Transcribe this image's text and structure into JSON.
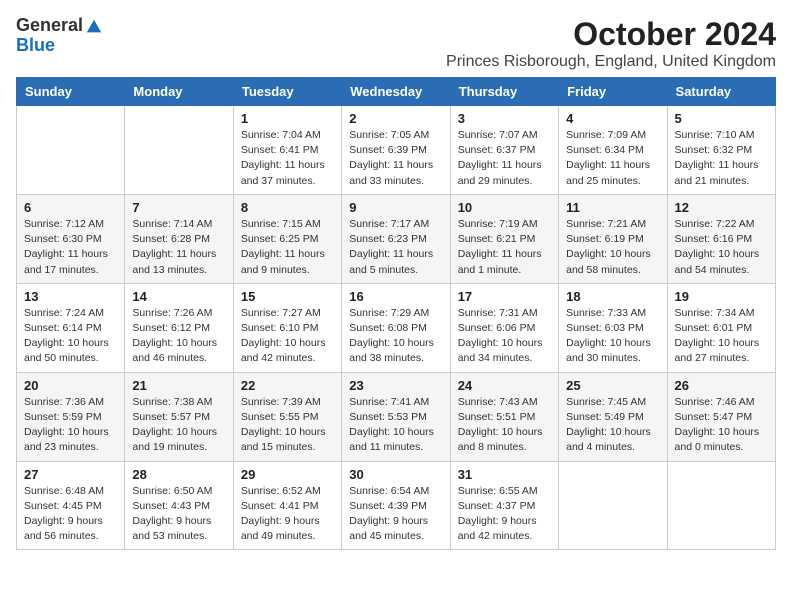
{
  "logo": {
    "general": "General",
    "blue": "Blue"
  },
  "title": "October 2024",
  "location": "Princes Risborough, England, United Kingdom",
  "weekdays": [
    "Sunday",
    "Monday",
    "Tuesday",
    "Wednesday",
    "Thursday",
    "Friday",
    "Saturday"
  ],
  "weeks": [
    [
      {
        "day": null
      },
      {
        "day": null
      },
      {
        "day": 1,
        "sunrise": "Sunrise: 7:04 AM",
        "sunset": "Sunset: 6:41 PM",
        "daylight": "Daylight: 11 hours and 37 minutes."
      },
      {
        "day": 2,
        "sunrise": "Sunrise: 7:05 AM",
        "sunset": "Sunset: 6:39 PM",
        "daylight": "Daylight: 11 hours and 33 minutes."
      },
      {
        "day": 3,
        "sunrise": "Sunrise: 7:07 AM",
        "sunset": "Sunset: 6:37 PM",
        "daylight": "Daylight: 11 hours and 29 minutes."
      },
      {
        "day": 4,
        "sunrise": "Sunrise: 7:09 AM",
        "sunset": "Sunset: 6:34 PM",
        "daylight": "Daylight: 11 hours and 25 minutes."
      },
      {
        "day": 5,
        "sunrise": "Sunrise: 7:10 AM",
        "sunset": "Sunset: 6:32 PM",
        "daylight": "Daylight: 11 hours and 21 minutes."
      }
    ],
    [
      {
        "day": 6,
        "sunrise": "Sunrise: 7:12 AM",
        "sunset": "Sunset: 6:30 PM",
        "daylight": "Daylight: 11 hours and 17 minutes."
      },
      {
        "day": 7,
        "sunrise": "Sunrise: 7:14 AM",
        "sunset": "Sunset: 6:28 PM",
        "daylight": "Daylight: 11 hours and 13 minutes."
      },
      {
        "day": 8,
        "sunrise": "Sunrise: 7:15 AM",
        "sunset": "Sunset: 6:25 PM",
        "daylight": "Daylight: 11 hours and 9 minutes."
      },
      {
        "day": 9,
        "sunrise": "Sunrise: 7:17 AM",
        "sunset": "Sunset: 6:23 PM",
        "daylight": "Daylight: 11 hours and 5 minutes."
      },
      {
        "day": 10,
        "sunrise": "Sunrise: 7:19 AM",
        "sunset": "Sunset: 6:21 PM",
        "daylight": "Daylight: 11 hours and 1 minute."
      },
      {
        "day": 11,
        "sunrise": "Sunrise: 7:21 AM",
        "sunset": "Sunset: 6:19 PM",
        "daylight": "Daylight: 10 hours and 58 minutes."
      },
      {
        "day": 12,
        "sunrise": "Sunrise: 7:22 AM",
        "sunset": "Sunset: 6:16 PM",
        "daylight": "Daylight: 10 hours and 54 minutes."
      }
    ],
    [
      {
        "day": 13,
        "sunrise": "Sunrise: 7:24 AM",
        "sunset": "Sunset: 6:14 PM",
        "daylight": "Daylight: 10 hours and 50 minutes."
      },
      {
        "day": 14,
        "sunrise": "Sunrise: 7:26 AM",
        "sunset": "Sunset: 6:12 PM",
        "daylight": "Daylight: 10 hours and 46 minutes."
      },
      {
        "day": 15,
        "sunrise": "Sunrise: 7:27 AM",
        "sunset": "Sunset: 6:10 PM",
        "daylight": "Daylight: 10 hours and 42 minutes."
      },
      {
        "day": 16,
        "sunrise": "Sunrise: 7:29 AM",
        "sunset": "Sunset: 6:08 PM",
        "daylight": "Daylight: 10 hours and 38 minutes."
      },
      {
        "day": 17,
        "sunrise": "Sunrise: 7:31 AM",
        "sunset": "Sunset: 6:06 PM",
        "daylight": "Daylight: 10 hours and 34 minutes."
      },
      {
        "day": 18,
        "sunrise": "Sunrise: 7:33 AM",
        "sunset": "Sunset: 6:03 PM",
        "daylight": "Daylight: 10 hours and 30 minutes."
      },
      {
        "day": 19,
        "sunrise": "Sunrise: 7:34 AM",
        "sunset": "Sunset: 6:01 PM",
        "daylight": "Daylight: 10 hours and 27 minutes."
      }
    ],
    [
      {
        "day": 20,
        "sunrise": "Sunrise: 7:36 AM",
        "sunset": "Sunset: 5:59 PM",
        "daylight": "Daylight: 10 hours and 23 minutes."
      },
      {
        "day": 21,
        "sunrise": "Sunrise: 7:38 AM",
        "sunset": "Sunset: 5:57 PM",
        "daylight": "Daylight: 10 hours and 19 minutes."
      },
      {
        "day": 22,
        "sunrise": "Sunrise: 7:39 AM",
        "sunset": "Sunset: 5:55 PM",
        "daylight": "Daylight: 10 hours and 15 minutes."
      },
      {
        "day": 23,
        "sunrise": "Sunrise: 7:41 AM",
        "sunset": "Sunset: 5:53 PM",
        "daylight": "Daylight: 10 hours and 11 minutes."
      },
      {
        "day": 24,
        "sunrise": "Sunrise: 7:43 AM",
        "sunset": "Sunset: 5:51 PM",
        "daylight": "Daylight: 10 hours and 8 minutes."
      },
      {
        "day": 25,
        "sunrise": "Sunrise: 7:45 AM",
        "sunset": "Sunset: 5:49 PM",
        "daylight": "Daylight: 10 hours and 4 minutes."
      },
      {
        "day": 26,
        "sunrise": "Sunrise: 7:46 AM",
        "sunset": "Sunset: 5:47 PM",
        "daylight": "Daylight: 10 hours and 0 minutes."
      }
    ],
    [
      {
        "day": 27,
        "sunrise": "Sunrise: 6:48 AM",
        "sunset": "Sunset: 4:45 PM",
        "daylight": "Daylight: 9 hours and 56 minutes."
      },
      {
        "day": 28,
        "sunrise": "Sunrise: 6:50 AM",
        "sunset": "Sunset: 4:43 PM",
        "daylight": "Daylight: 9 hours and 53 minutes."
      },
      {
        "day": 29,
        "sunrise": "Sunrise: 6:52 AM",
        "sunset": "Sunset: 4:41 PM",
        "daylight": "Daylight: 9 hours and 49 minutes."
      },
      {
        "day": 30,
        "sunrise": "Sunrise: 6:54 AM",
        "sunset": "Sunset: 4:39 PM",
        "daylight": "Daylight: 9 hours and 45 minutes."
      },
      {
        "day": 31,
        "sunrise": "Sunrise: 6:55 AM",
        "sunset": "Sunset: 4:37 PM",
        "daylight": "Daylight: 9 hours and 42 minutes."
      },
      {
        "day": null
      },
      {
        "day": null
      }
    ]
  ]
}
